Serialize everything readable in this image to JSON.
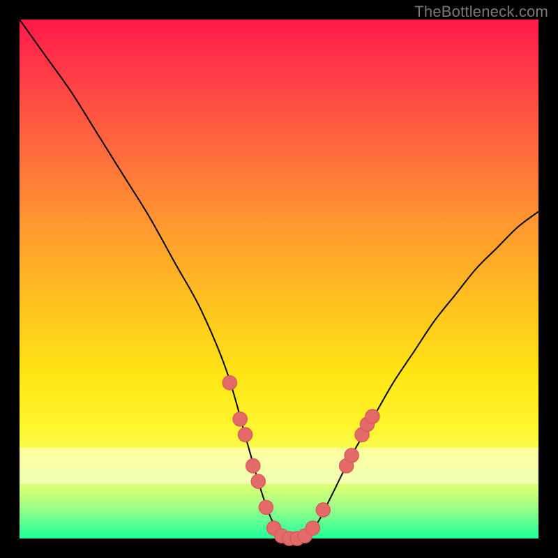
{
  "watermark": "TheBottleneck.com",
  "colors": {
    "frame": "#000000",
    "curve": "#000000",
    "marker": "#e46a6a",
    "marker_stroke": "#d85a5a"
  },
  "chart_data": {
    "type": "line",
    "title": "",
    "xlabel": "",
    "ylabel": "",
    "xlim": [
      0,
      100
    ],
    "ylim": [
      0,
      100
    ],
    "grid": false,
    "series": [
      {
        "name": "bottleneck-curve",
        "x": [
          0,
          5,
          10,
          15,
          20,
          25,
          30,
          35,
          40,
          44,
          46,
          48,
          50,
          52,
          54,
          56,
          58,
          60,
          64,
          68,
          72,
          76,
          80,
          84,
          88,
          92,
          96,
          100
        ],
        "y": [
          100,
          93,
          86,
          78,
          70,
          62,
          53,
          44,
          32,
          18,
          11,
          5,
          1,
          0,
          0,
          1,
          4,
          8,
          16,
          23,
          30,
          36,
          42,
          47,
          52,
          56,
          60,
          63
        ]
      }
    ],
    "markers": {
      "name": "highlight-dots",
      "points": [
        {
          "x": 40.5,
          "y": 30
        },
        {
          "x": 42.5,
          "y": 23
        },
        {
          "x": 43.5,
          "y": 20
        },
        {
          "x": 45.0,
          "y": 14
        },
        {
          "x": 46.0,
          "y": 11
        },
        {
          "x": 47.5,
          "y": 6
        },
        {
          "x": 49.0,
          "y": 2
        },
        {
          "x": 50.5,
          "y": 0.5
        },
        {
          "x": 52.0,
          "y": 0
        },
        {
          "x": 53.5,
          "y": 0
        },
        {
          "x": 55.0,
          "y": 0.5
        },
        {
          "x": 56.5,
          "y": 2
        },
        {
          "x": 58.5,
          "y": 5.5
        },
        {
          "x": 63.0,
          "y": 14
        },
        {
          "x": 64.0,
          "y": 16
        },
        {
          "x": 66.0,
          "y": 20
        },
        {
          "x": 67.0,
          "y": 22
        },
        {
          "x": 68.0,
          "y": 23.5
        }
      ]
    }
  }
}
